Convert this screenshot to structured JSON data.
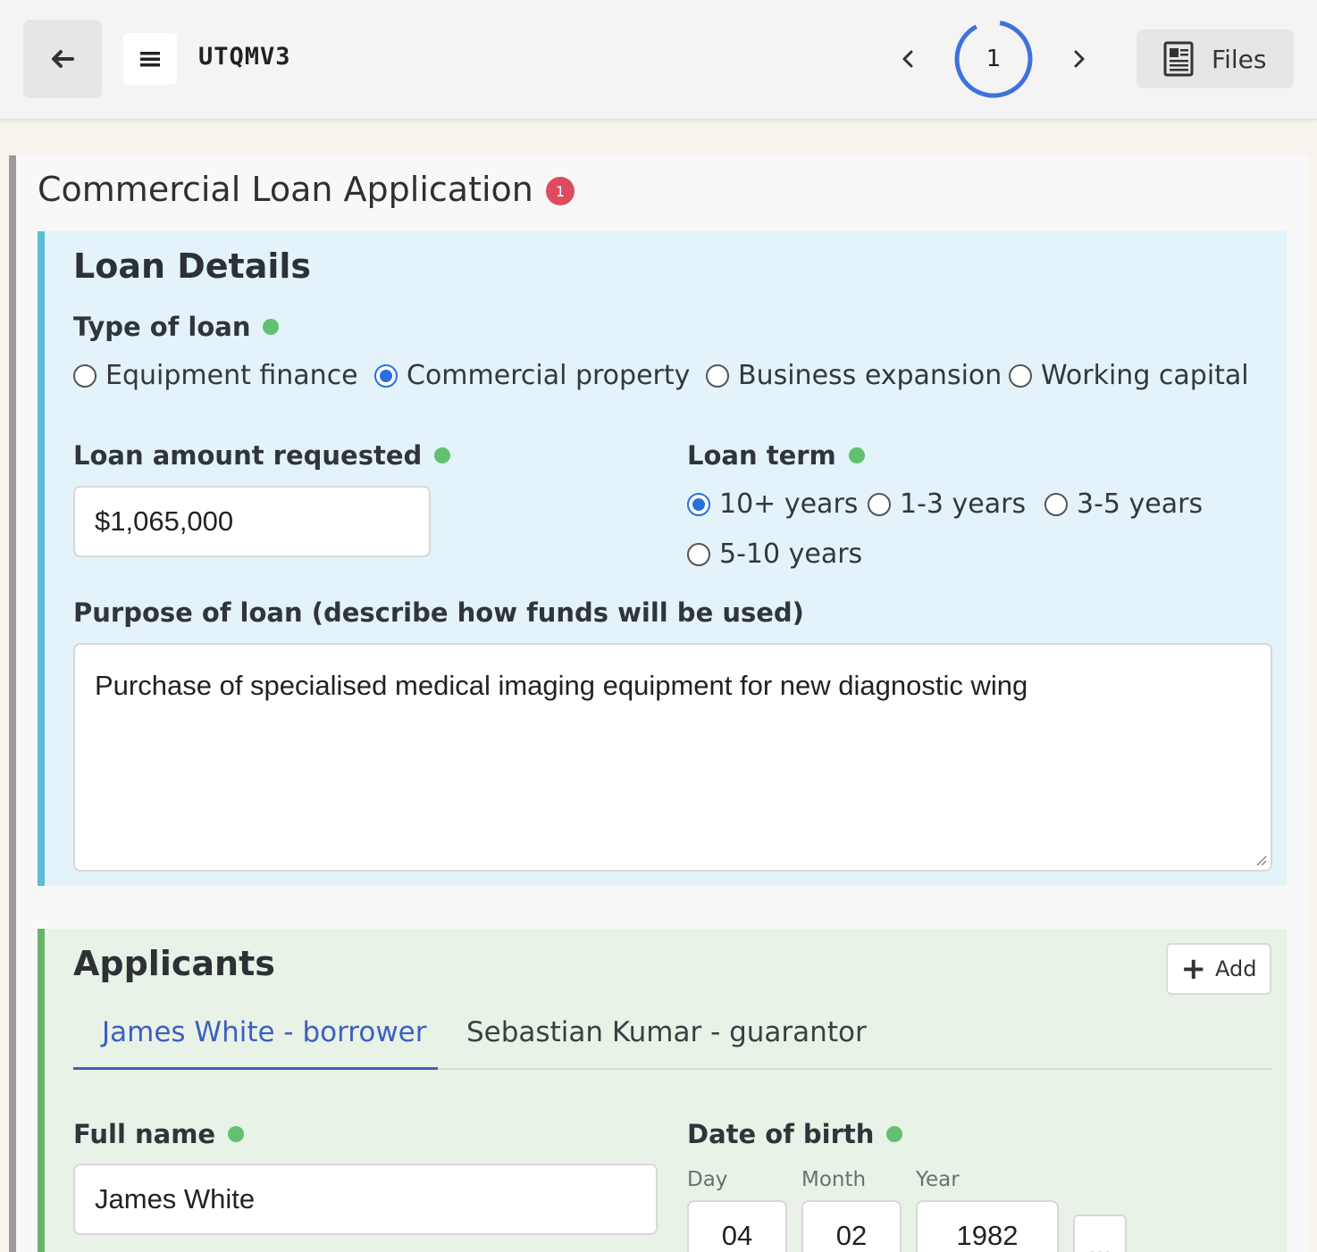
{
  "header": {
    "doc_code": "UTQMV3",
    "page_number": "1",
    "files_label": "Files"
  },
  "form": {
    "title": "Commercial Loan Application",
    "error_count": "1"
  },
  "loan_details": {
    "title": "Loan Details",
    "type_label": "Type of loan",
    "type_options": [
      "Equipment finance",
      "Commercial property",
      "Business expansion",
      "Working capital"
    ],
    "type_selected": "Commercial property",
    "amount_label": "Loan amount requested",
    "amount_value": "$1,065,000",
    "term_label": "Loan term",
    "term_options": [
      "10+ years",
      "1-3 years",
      "3-5 years",
      "5-10 years"
    ],
    "term_selected": "10+ years",
    "purpose_label": "Purpose of loan (describe how funds will be used)",
    "purpose_value": "Purchase of specialised medical imaging equipment for new diagnostic wing"
  },
  "applicants": {
    "title": "Applicants",
    "add_label": "Add",
    "tabs": [
      "James White - borrower",
      "Sebastian Kumar - guarantor"
    ],
    "active_tab": "James White - borrower",
    "full_name_label": "Full name",
    "full_name_value": "James White",
    "dob_label": "Date of birth",
    "dob_day_label": "Day",
    "dob_month_label": "Month",
    "dob_year_label": "Year",
    "dob_day": "04",
    "dob_month": "02",
    "dob_year": "1982",
    "more_label": "..."
  },
  "colors": {
    "accent_blue": "#2a6fe0",
    "loan_section_bg": "#e3f3f9",
    "applicants_section_bg": "#e8f2e6",
    "valid_dot": "#62c070",
    "error_badge": "#dd4c5e",
    "active_tab": "#3d5fbf"
  },
  "icons": {
    "back": "arrow-left-icon",
    "menu": "hamburger-icon",
    "prev": "chevron-left-icon",
    "next": "chevron-right-icon",
    "files": "document-icon",
    "add": "plus-icon"
  }
}
